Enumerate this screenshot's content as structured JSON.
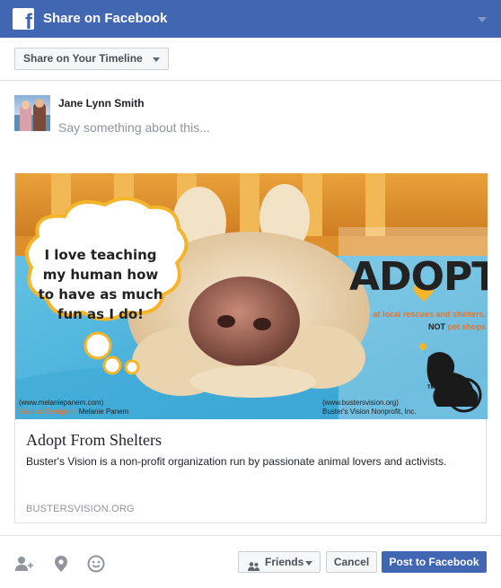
{
  "header": {
    "logo_letter": "f",
    "title": "Share on Facebook"
  },
  "audience": {
    "selected": "Share on Your Timeline"
  },
  "composer": {
    "user_name": "Jane Lynn Smith",
    "placeholder": "Say something about this..."
  },
  "link_preview": {
    "image": {
      "bubble_text": "I love teaching my human how to have as much fun as I do!",
      "adopt": "ADOPT",
      "adopt_line1": "at local rescues and shelters,",
      "adopt_line2_not": "NOT",
      "adopt_line2_rest": " pet shops",
      "credit_site": "(www.melaniepanem.com)",
      "credit_designer_label": "Graphic Designer:",
      "credit_designer_name": " Melanie Panem",
      "bv_site": "(www.bustersvision.org)",
      "bv_name": "Buster's Vision Nonprofit, Inc.",
      "bv_logo_text": "BVN",
      "bv_tm": "TM"
    },
    "title": "Adopt From Shelters",
    "description": "Buster's Vision is a non-profit organization run by passionate animal lovers and activists.",
    "domain": "BUSTERSVISION.ORG"
  },
  "footer": {
    "icons": [
      "tag-friends-icon",
      "location-pin-icon",
      "feeling-smiley-icon"
    ],
    "privacy_label": "Friends",
    "cancel_label": "Cancel",
    "post_label": "Post to Facebook"
  },
  "colors": {
    "brand_blue": "#4267b2",
    "accent_orange": "#e8742a",
    "border": "#dddfe2"
  }
}
